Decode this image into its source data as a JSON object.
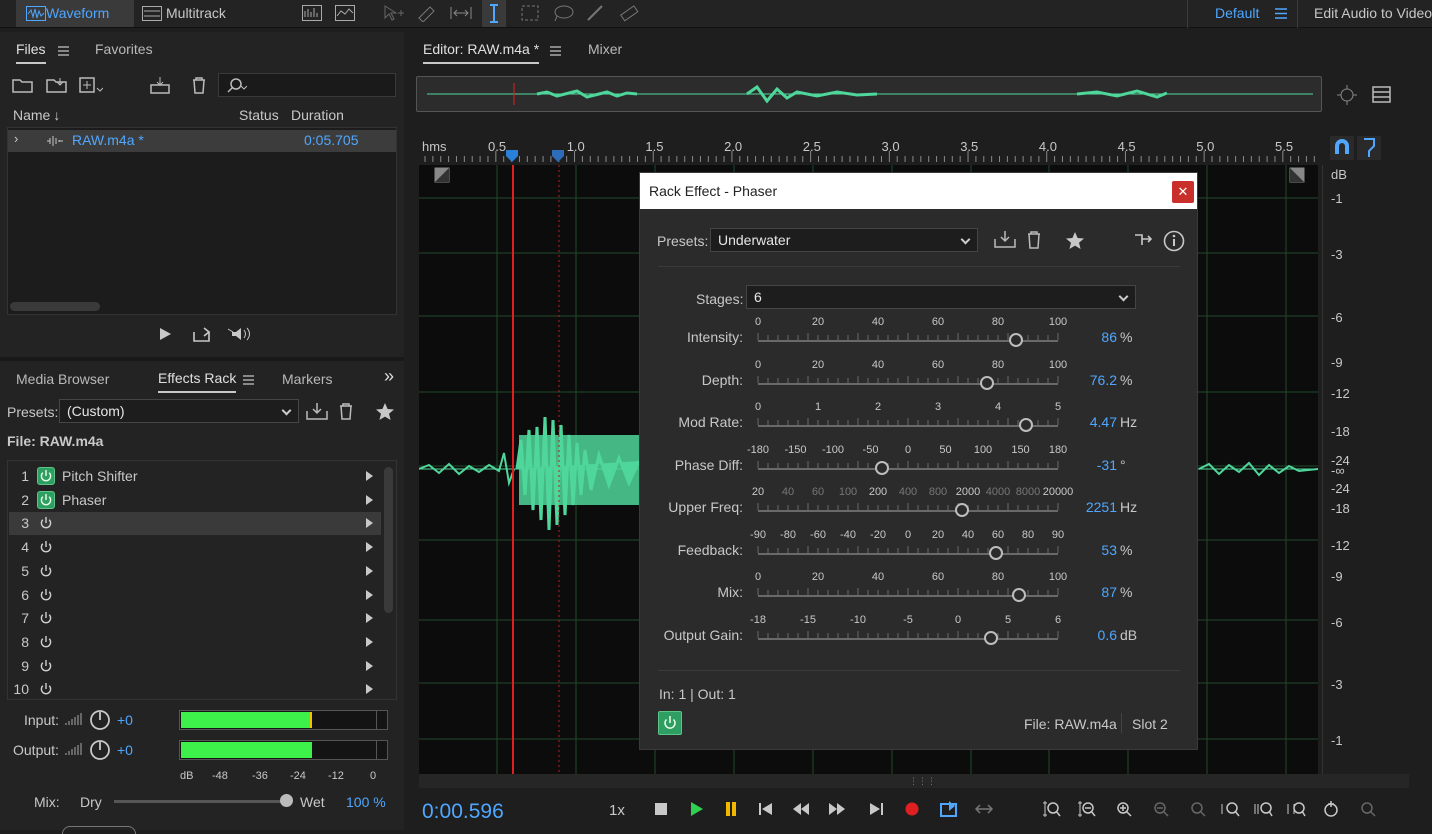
{
  "topbar": {
    "waveform_label": "Waveform",
    "multitrack_label": "Multitrack",
    "workspace_label": "Default",
    "edit_audio_label": "Edit Audio to Video"
  },
  "files_panel": {
    "tab_files": "Files",
    "tab_favorites": "Favorites",
    "columns": {
      "name": "Name",
      "status": "Status",
      "duration": "Duration"
    },
    "file": {
      "name": "RAW.m4a *",
      "duration": "0:05.705"
    }
  },
  "effects_panel": {
    "tab_media_browser": "Media Browser",
    "tab_effects_rack": "Effects Rack",
    "tab_markers": "Markers",
    "presets_label": "Presets:",
    "preset_value": "(Custom)",
    "file_label": "File: RAW.m4a",
    "slots": [
      {
        "num": "1",
        "name": "Pitch Shifter",
        "on": true
      },
      {
        "num": "2",
        "name": "Phaser",
        "on": true
      },
      {
        "num": "3",
        "name": "",
        "on": false
      },
      {
        "num": "4",
        "name": "",
        "on": false
      },
      {
        "num": "5",
        "name": "",
        "on": false
      },
      {
        "num": "6",
        "name": "",
        "on": false
      },
      {
        "num": "7",
        "name": "",
        "on": false
      },
      {
        "num": "8",
        "name": "",
        "on": false
      },
      {
        "num": "9",
        "name": "",
        "on": false
      },
      {
        "num": "10",
        "name": "",
        "on": false
      }
    ],
    "input_label": "Input:",
    "input_value": "+0",
    "output_label": "Output:",
    "output_value": "+0",
    "meter_scale": [
      "dB",
      "-48",
      "-36",
      "-24",
      "-12",
      "0"
    ],
    "input_level": 0.66,
    "output_level": 0.67,
    "mix_label": "Mix:",
    "dry_label": "Dry",
    "wet_label": "Wet",
    "mix_value": "100 %"
  },
  "editor": {
    "tab_editor": "Editor: RAW.m4a *",
    "tab_mixer": "Mixer",
    "ruler_unit": "hms",
    "ruler_ticks": [
      "0.5",
      "1.0",
      "1.5",
      "2.0",
      "2.5",
      "3.0",
      "3.5",
      "4.0",
      "4.5",
      "5.0",
      "5.5"
    ],
    "db_label": "dB",
    "db_scale": [
      "-1",
      "-3",
      "-6",
      "-9",
      "-12",
      "-18",
      "-24",
      "-∞",
      "-24",
      "-18",
      "-12",
      "-9",
      "-6",
      "-3",
      "-1"
    ],
    "time": "0:00.596",
    "speed": "1x"
  },
  "dialog": {
    "title": "Rack Effect - Phaser",
    "presets_label": "Presets:",
    "preset_value": "Underwater",
    "stages_label": "Stages:",
    "stages_value": "6",
    "params": [
      {
        "label": "Intensity:",
        "value": "86",
        "unit": "%",
        "ticks": [
          "0",
          "20",
          "40",
          "60",
          "80",
          "100"
        ],
        "fraction": 0.86
      },
      {
        "label": "Depth:",
        "value": "76.2",
        "unit": "%",
        "ticks": [
          "0",
          "20",
          "40",
          "60",
          "80",
          "100"
        ],
        "fraction": 0.762
      },
      {
        "label": "Mod Rate:",
        "value": "4.47",
        "unit": "Hz",
        "ticks": [
          "0",
          "1",
          "2",
          "3",
          "4",
          "5"
        ],
        "fraction": 0.894
      },
      {
        "label": "Phase Diff:",
        "value": "-31",
        "unit": "°",
        "ticks": [
          "-180",
          "-150",
          "-100",
          "-50",
          "0",
          "50",
          "100",
          "150",
          "180"
        ],
        "fraction": 0.414
      },
      {
        "label": "Upper Freq:",
        "value": "2251",
        "unit": "Hz",
        "ticks": [
          "20",
          "40",
          "60",
          "100",
          "200",
          "400",
          "800",
          "2000",
          "4000",
          "8000",
          "20000"
        ],
        "fraction": 0.68
      },
      {
        "label": "Feedback:",
        "value": "53",
        "unit": "%",
        "ticks": [
          "-90",
          "-80",
          "-60",
          "-40",
          "-20",
          "0",
          "20",
          "40",
          "60",
          "80",
          "90"
        ],
        "fraction": 0.794
      },
      {
        "label": "Mix:",
        "value": "87",
        "unit": "%",
        "ticks": [
          "0",
          "20",
          "40",
          "60",
          "80",
          "100"
        ],
        "fraction": 0.87
      },
      {
        "label": "Output Gain:",
        "value": "0.6",
        "unit": "dB",
        "ticks": [
          "-18",
          "-15",
          "-10",
          "-5",
          "0",
          "5",
          "6"
        ],
        "fraction": 0.775
      }
    ],
    "io_label": "In: 1 | Out: 1",
    "file_label": "File: RAW.m4a",
    "slot_label": "Slot 2"
  },
  "colors": {
    "accent_blue": "#4fa7ff",
    "waveform_green": "#4fd69a",
    "power_green": "#2f9e62",
    "meter_green": "#3ef04a",
    "playhead_red": "#e02020",
    "close_red": "#c9302c"
  }
}
